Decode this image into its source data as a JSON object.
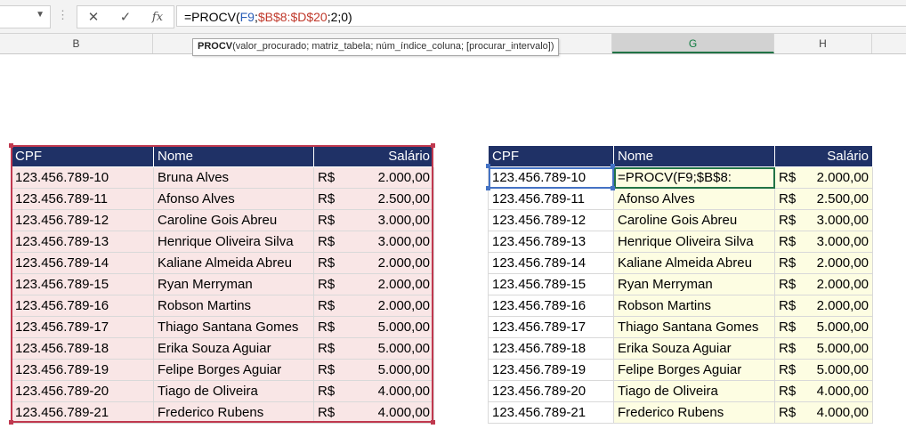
{
  "formula_bar": {
    "name_box_value": "",
    "cancel_icon": "✕",
    "enter_icon": "✓",
    "fx_label": "fx",
    "formula_parts": {
      "prefix": "=PROCV(",
      "ref1": "F9",
      "sep1": ";",
      "ref2": "$B$8:$D$20",
      "suffix": ";2;0)"
    }
  },
  "column_headers": {
    "B": "B",
    "G": "G",
    "H": "H"
  },
  "tooltip": {
    "function": "PROCV",
    "args": "(valor_procurado; matriz_tabela; núm_índice_coluna; [procurar_intervalo])"
  },
  "left_table": {
    "headers": {
      "cpf": "CPF",
      "nome": "Nome",
      "salario": "Salário"
    },
    "currency": "R$",
    "rows": [
      {
        "cpf": "123.456.789-10",
        "nome": "Bruna Alves",
        "salario": "2.000,00"
      },
      {
        "cpf": "123.456.789-11",
        "nome": "Afonso Alves",
        "salario": "2.500,00"
      },
      {
        "cpf": "123.456.789-12",
        "nome": "Caroline Gois Abreu",
        "salario": "3.000,00"
      },
      {
        "cpf": "123.456.789-13",
        "nome": "Henrique Oliveira Silva",
        "salario": "3.000,00"
      },
      {
        "cpf": "123.456.789-14",
        "nome": "Kaliane Almeida Abreu",
        "salario": "2.000,00"
      },
      {
        "cpf": "123.456.789-15",
        "nome": "Ryan Merryman",
        "salario": "2.000,00"
      },
      {
        "cpf": "123.456.789-16",
        "nome": "Robson Martins",
        "salario": "2.000,00"
      },
      {
        "cpf": "123.456.789-17",
        "nome": "Thiago Santana Gomes",
        "salario": "5.000,00"
      },
      {
        "cpf": "123.456.789-18",
        "nome": "Erika Souza Aguiar",
        "salario": "5.000,00"
      },
      {
        "cpf": "123.456.789-19",
        "nome": "Felipe Borges Aguiar",
        "salario": "5.000,00"
      },
      {
        "cpf": "123.456.789-20",
        "nome": "Tiago de Oliveira",
        "salario": "4.000,00"
      },
      {
        "cpf": "123.456.789-21",
        "nome": "Frederico Rubens",
        "salario": "4.000,00"
      }
    ]
  },
  "right_table": {
    "headers": {
      "cpf": "CPF",
      "nome": "Nome",
      "salario": "Salário"
    },
    "currency": "R$",
    "editing_text": "=PROCV(F9;$B$8:",
    "rows": [
      {
        "cpf": "123.456.789-10",
        "nome": "",
        "salario": "2.000,00"
      },
      {
        "cpf": "123.456.789-11",
        "nome": "Afonso Alves",
        "salario": "2.500,00"
      },
      {
        "cpf": "123.456.789-12",
        "nome": "Caroline Gois Abreu",
        "salario": "3.000,00"
      },
      {
        "cpf": "123.456.789-13",
        "nome": "Henrique Oliveira Silva",
        "salario": "3.000,00"
      },
      {
        "cpf": "123.456.789-14",
        "nome": "Kaliane Almeida Abreu",
        "salario": "2.000,00"
      },
      {
        "cpf": "123.456.789-15",
        "nome": "Ryan Merryman",
        "salario": "2.000,00"
      },
      {
        "cpf": "123.456.789-16",
        "nome": "Robson Martins",
        "salario": "2.000,00"
      },
      {
        "cpf": "123.456.789-17",
        "nome": "Thiago Santana Gomes",
        "salario": "5.000,00"
      },
      {
        "cpf": "123.456.789-18",
        "nome": "Erika Souza Aguiar",
        "salario": "5.000,00"
      },
      {
        "cpf": "123.456.789-19",
        "nome": "Felipe Borges Aguiar",
        "salario": "5.000,00"
      },
      {
        "cpf": "123.456.789-20",
        "nome": "Tiago de Oliveira",
        "salario": "4.000,00"
      },
      {
        "cpf": "123.456.789-21",
        "nome": "Frederico Rubens",
        "salario": "4.000,00"
      }
    ]
  },
  "colors": {
    "header_bg": "#1f3166",
    "left_fill": "#f9e6e6",
    "left_border": "#c0394f",
    "right_fill": "#fdfde2",
    "ref_blue": "#2b5fb8",
    "ref_red": "#c0392b",
    "excel_green": "#217346"
  }
}
